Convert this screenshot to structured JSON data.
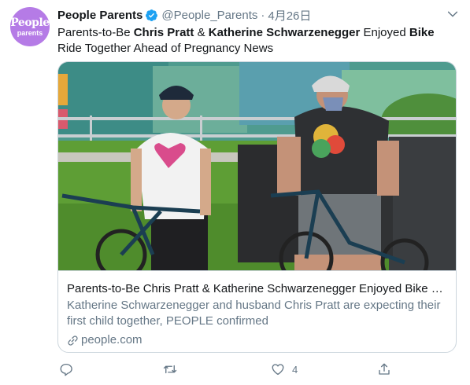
{
  "avatar": {
    "line1": "People",
    "line2": "parents"
  },
  "tweet": {
    "name": "People Parents",
    "handle": "@People_Parents",
    "separator": "·",
    "date": "4月26日",
    "text": {
      "p1": "Parents-to-Be ",
      "b1": "Chris Pratt",
      "p2": " & ",
      "b2": "Katherine Schwarzenegger",
      "p3": " Enjoyed ",
      "b3": "Bike",
      "p4": " Ride Together Ahead of Pregnancy News"
    }
  },
  "card": {
    "title": "Parents-to-Be Chris Pratt & Katherine Schwarzenegger Enjoyed Bike Ride Together Ahead of Pregnancy News",
    "description": "Katherine Schwarzenegger and husband Chris Pratt are expecting their first child together, PEOPLE confirmed",
    "domain": "people.com"
  },
  "actions": {
    "reply": {
      "icon": "reply-icon",
      "count": ""
    },
    "retweet": {
      "icon": "retweet-icon",
      "count": ""
    },
    "like": {
      "icon": "heart-icon",
      "count": "4"
    },
    "share": {
      "icon": "share-icon",
      "count": ""
    }
  },
  "colors": {
    "verified": "#1da1f2",
    "secondary_text": "#657786",
    "border": "#ccd6dd",
    "avatar_bg": "#b57be6"
  }
}
